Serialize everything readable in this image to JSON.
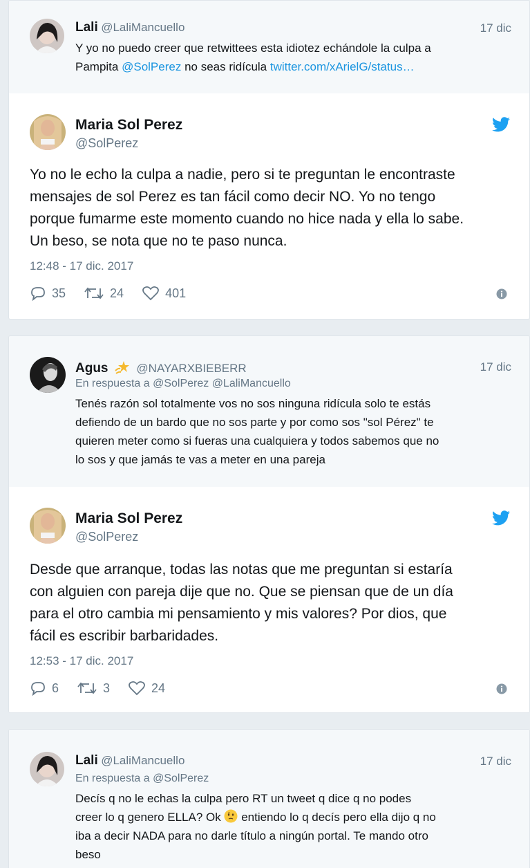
{
  "tweet1": {
    "name": "Lali",
    "handle": "@LaliMancuello",
    "date": "17 dic",
    "text_a": "Y yo no puedo creer que retwittees esta idiotez echándole la culpa a",
    "text_b": "Pampita ",
    "mention": "@SolPerez",
    "text_c": " no seas ridícula ",
    "link": "twitter.com/xArielG/status…"
  },
  "tweet2": {
    "name": "Maria Sol Perez",
    "handle": "@SolPerez",
    "lines": [
      "Yo no le echo la culpa a nadie, pero si te preguntan le encontraste",
      "mensajes de sol Perez es tan fácil como decir NO. Yo no tengo",
      "porque fumarme este momento cuando no hice nada y ella lo sabe.",
      "Un beso, se nota que no te paso nunca."
    ],
    "timestamp": "12:48 - 17 dic. 2017",
    "replies": "35",
    "retweets": "24",
    "likes": "401"
  },
  "tweet3": {
    "name": "Agus",
    "handle": "@NAYARXBIEBERR",
    "date": "17 dic",
    "reply_prefix": "En respuesta a",
    "reply_to": "@SolPerez @LaliMancuello",
    "lines": [
      "Tenés razón sol totalmente vos no sos ninguna ridícula solo te estás",
      "defiendo de un bardo que no sos parte y por como sos \"sol Pérez\" te",
      "quieren meter como si fueras una cualquiera y todos sabemos que no",
      "lo sos y que jamás te vas a meter en una pareja"
    ]
  },
  "tweet4": {
    "name": "Maria Sol Perez",
    "handle": "@SolPerez",
    "lines": [
      "Desde que arranque, todas las notas que me preguntan si estaría",
      "con alguien con pareja dije que no. Que se piensan que de un día",
      "para el otro cambia mi pensamiento y mis valores? Por dios, que",
      "fácil es escribir barbaridades."
    ],
    "timestamp": "12:53 - 17 dic. 2017",
    "replies": "6",
    "retweets": "3",
    "likes": "24"
  },
  "tweet5": {
    "name": "Lali",
    "handle": "@LaliMancuello",
    "date": "17 dic",
    "reply_prefix": "En respuesta a",
    "reply_to": "@SolPerez",
    "line1": "Decís q no le echas la culpa pero RT un tweet q dice q no podes",
    "line2a": "creer lo q genero ELLA? Ok ",
    "line2b": " entiendo lo q decís pero ella dijo q no",
    "line3": "iba a decir NADA para no darle título a ningún portal. Te mando otro",
    "line4": "beso"
  },
  "colors": {
    "twitter_blue": "#1da1f2",
    "link_blue": "#1b95e0",
    "secondary_text": "#657786",
    "reply_bg": "#f5f8fa",
    "page_bg": "#e8edf1"
  },
  "icons": [
    "twitter-bird-icon",
    "reply-icon",
    "retweet-icon",
    "like-icon",
    "info-icon",
    "star-icon",
    "thinking-emoji"
  ]
}
